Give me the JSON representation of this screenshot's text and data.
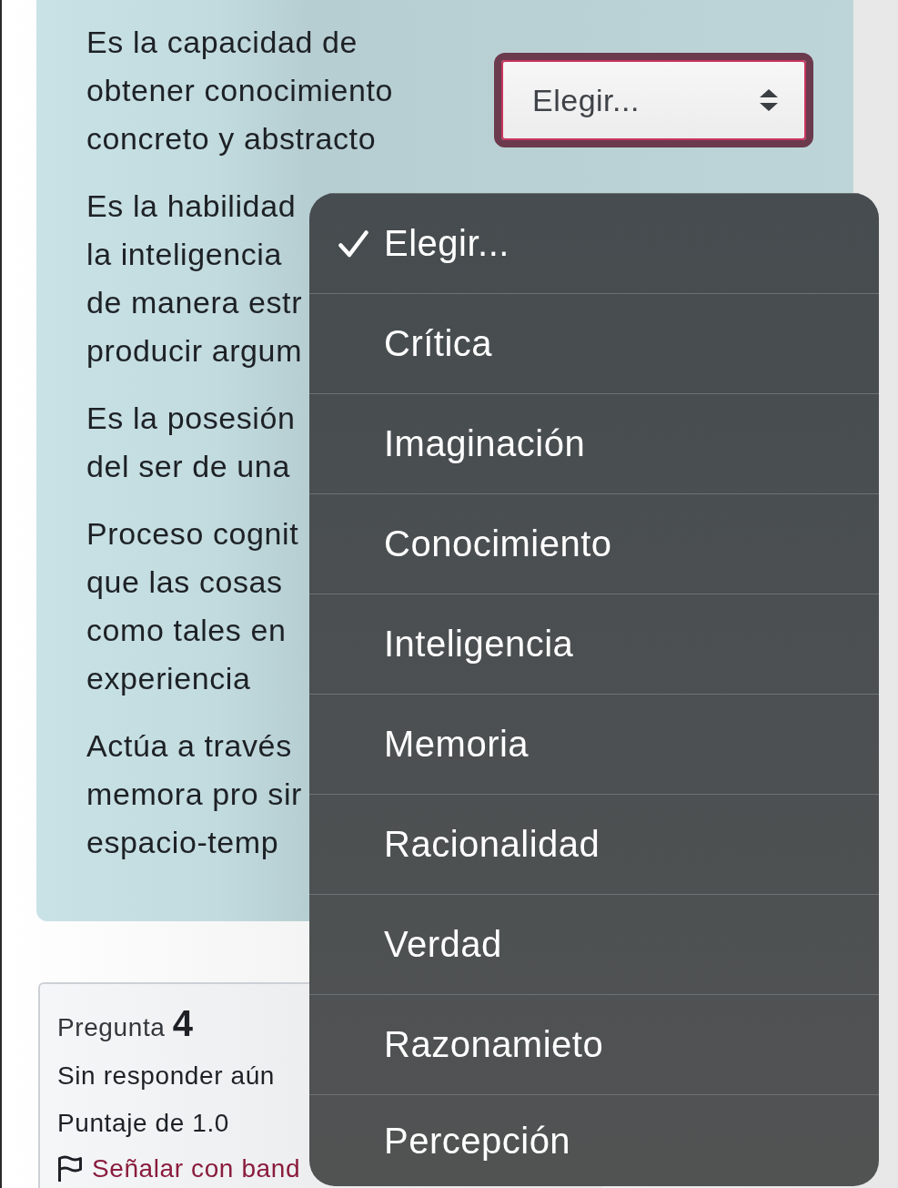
{
  "question_rows": [
    {
      "lines": [
        "Es la capacidad de",
        "obtener conocimiento",
        "concreto y abstracto"
      ],
      "select": {
        "value": "Elegir...",
        "focused": true
      }
    },
    {
      "lines": [
        "Es la habilidad",
        "la inteligencia",
        "de manera estr",
        "producir argum"
      ]
    },
    {
      "lines": [
        "Es la posesión",
        "del ser de una"
      ]
    },
    {
      "lines": [
        "Proceso cognit",
        "que las cosas",
        "como tales en",
        "experiencia"
      ]
    },
    {
      "lines": [
        "Actúa a través",
        "memora pro sir",
        "espacio-temp"
      ]
    }
  ],
  "question_card": {
    "title": "Pregunta **4**",
    "status": "Sin responder aún",
    "grade": "Puntaje de 1.0",
    "flag_link": "Señalar con band"
  },
  "dropdown": {
    "options": [
      {
        "label": "Elegir...",
        "selected": true
      },
      {
        "label": "Crítica",
        "selected": false
      },
      {
        "label": "Imaginación",
        "selected": false
      },
      {
        "label": "Conocimiento",
        "selected": false
      },
      {
        "label": "Inteligencia",
        "selected": false
      },
      {
        "label": "Memoria",
        "selected": false
      },
      {
        "label": "Racionalidad",
        "selected": false
      },
      {
        "label": "Verdad",
        "selected": false
      },
      {
        "label": "Razonamieto",
        "selected": false
      },
      {
        "label": "Percepción",
        "selected": false
      }
    ]
  }
}
